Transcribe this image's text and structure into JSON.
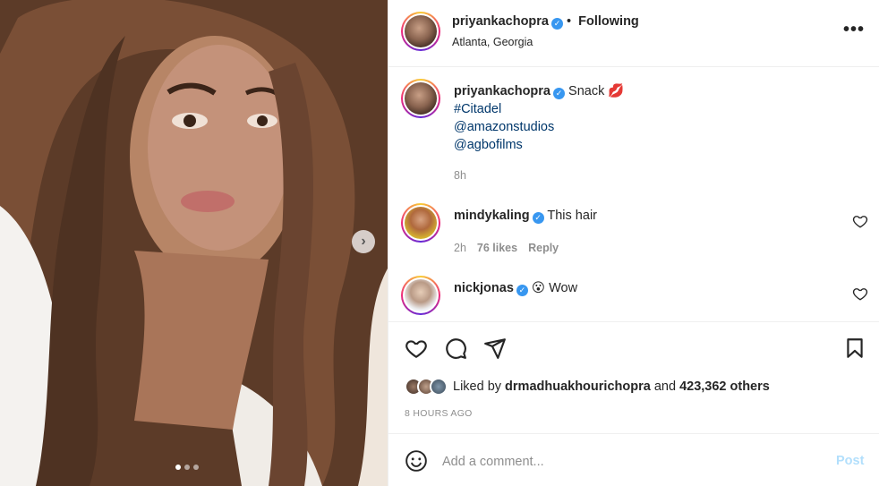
{
  "post": {
    "username": "priyankachopra",
    "following_label": "Following",
    "location": "Atlanta, Georgia",
    "more_label": "•••"
  },
  "caption": {
    "username": "priyankachopra",
    "text": "Snack",
    "emoji": "💋",
    "hashtag": "#Citadel",
    "mention1": "@amazonstudios",
    "mention2": "@agbofilms",
    "time": "8h"
  },
  "comments": [
    {
      "username": "mindykaling",
      "text": "This hair",
      "time": "2h",
      "likes": "76 likes",
      "reply": "Reply"
    },
    {
      "username": "nickjonas",
      "emoji": "😮",
      "text": "Wow"
    }
  ],
  "likes": {
    "prefix": "Liked by",
    "user": "drmadhuakhourichopra",
    "middle": "and",
    "count": "423,362 others"
  },
  "timeago": "8 HOURS AGO",
  "add_comment": {
    "placeholder": "Add a comment...",
    "post_label": "Post"
  },
  "colors": {
    "verified": "#3897f0",
    "link": "#00376b",
    "post_disabled": "#b2dffc"
  }
}
